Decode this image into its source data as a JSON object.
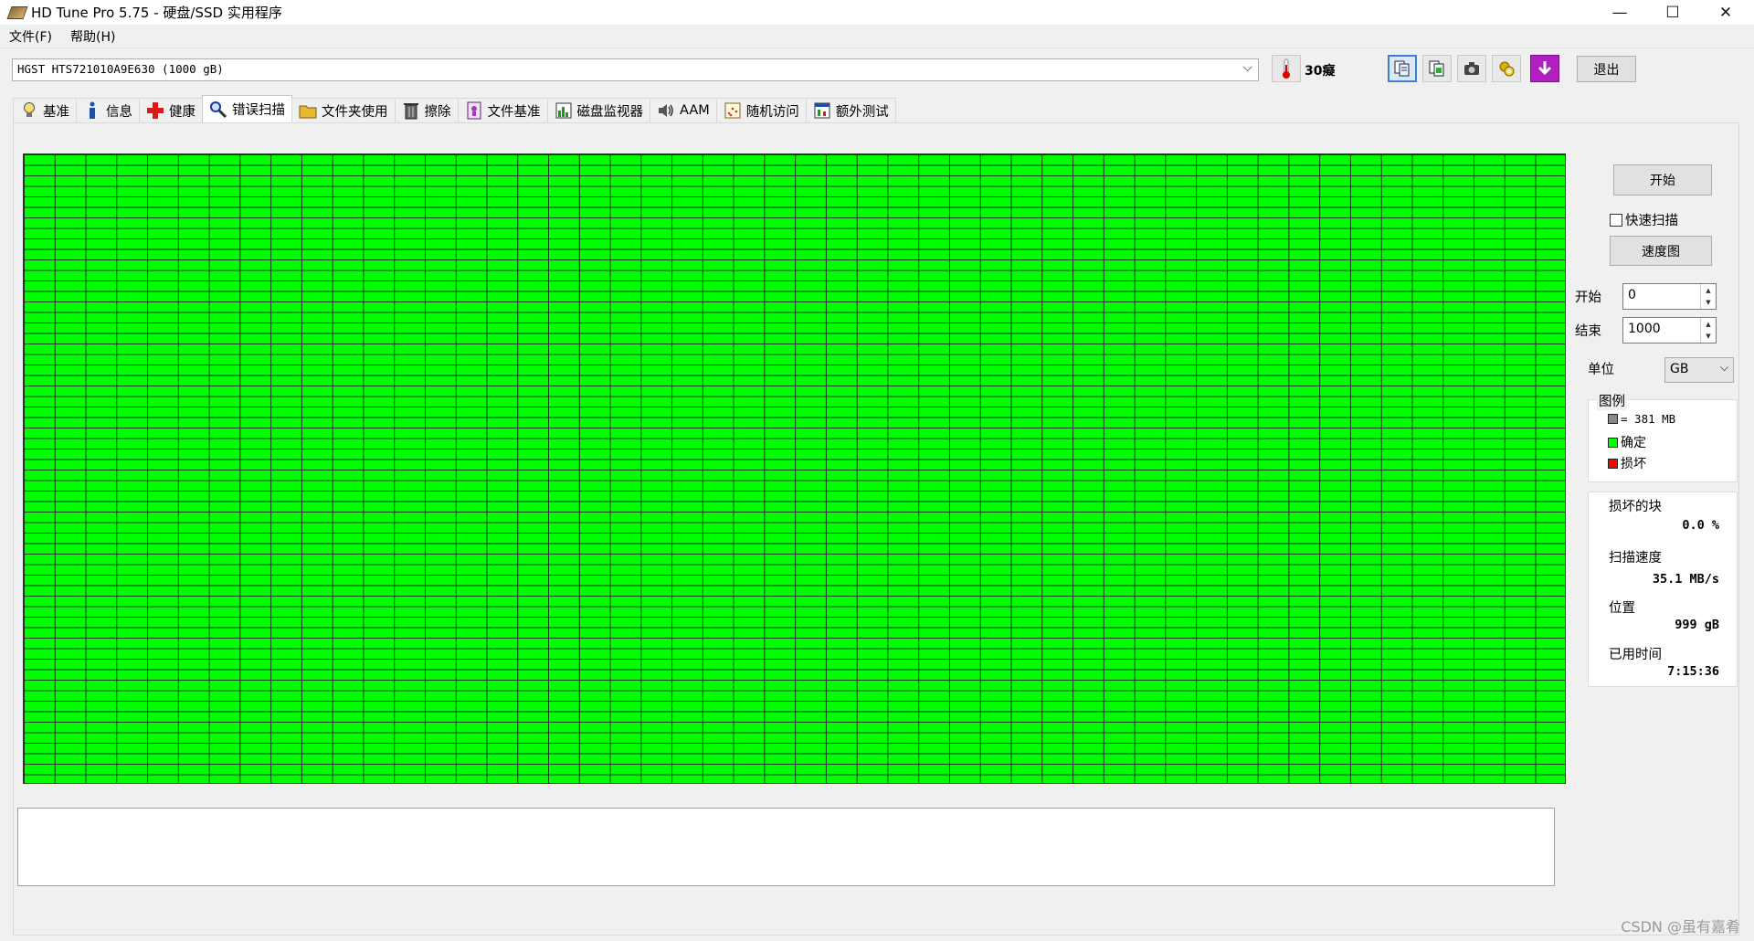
{
  "window": {
    "title": "HD Tune Pro 5.75 - 硬盘/SSD 实用程序",
    "minimize": "—",
    "maximize": "☐",
    "close": "✕"
  },
  "menu": [
    {
      "label": "文件(F)"
    },
    {
      "label": "帮助(H)"
    }
  ],
  "toolbar": {
    "drive": "HGST HTS721010A9E630 (1000 gB)",
    "temperature": "30癡",
    "exit_label": "退出",
    "buttons": [
      "copy-text-icon",
      "copy-info-icon",
      "screenshot-icon",
      "settings-icon",
      "download-icon"
    ]
  },
  "tabs": [
    {
      "label": "基准",
      "icon": "bulb-icon"
    },
    {
      "label": "信息",
      "icon": "info-icon"
    },
    {
      "label": "健康",
      "icon": "health-cross-icon"
    },
    {
      "label": "错误扫描",
      "icon": "magnifier-icon",
      "active": true
    },
    {
      "label": "文件夹使用",
      "icon": "folder-icon"
    },
    {
      "label": "擦除",
      "icon": "trash-icon"
    },
    {
      "label": "文件基准",
      "icon": "file-bench-icon"
    },
    {
      "label": "磁盘监视器",
      "icon": "monitor-chart-icon"
    },
    {
      "label": "AAM",
      "icon": "speaker-icon"
    },
    {
      "label": "随机访问",
      "icon": "random-access-icon"
    },
    {
      "label": "额外测试",
      "icon": "extra-test-icon"
    }
  ],
  "scan": {
    "start_button": "开始",
    "quick_scan_label": "快速扫描",
    "quick_scan_checked": false,
    "speed_map_button": "速度图",
    "start_label": "开始",
    "start_value": "0",
    "end_label": "结束",
    "end_value": "1000",
    "unit_label": "单位",
    "unit_value": "GB",
    "block_status": "all-ok",
    "ok_color": "#00ff00",
    "bad_color": "#ff0000"
  },
  "legend": {
    "title": "图例",
    "block_size": "= 381 MB",
    "ok": "确定",
    "bad": "损坏"
  },
  "stats": {
    "damaged_label": "损坏的块",
    "damaged_value": "0.0 %",
    "speed_label": "扫描速度",
    "speed_value": "35.1 MB/s",
    "position_label": "位置",
    "position_value": "999 gB",
    "elapsed_label": "已用时间",
    "elapsed_value": "7:15:36"
  },
  "watermark": "CSDN @虽有嘉肴"
}
